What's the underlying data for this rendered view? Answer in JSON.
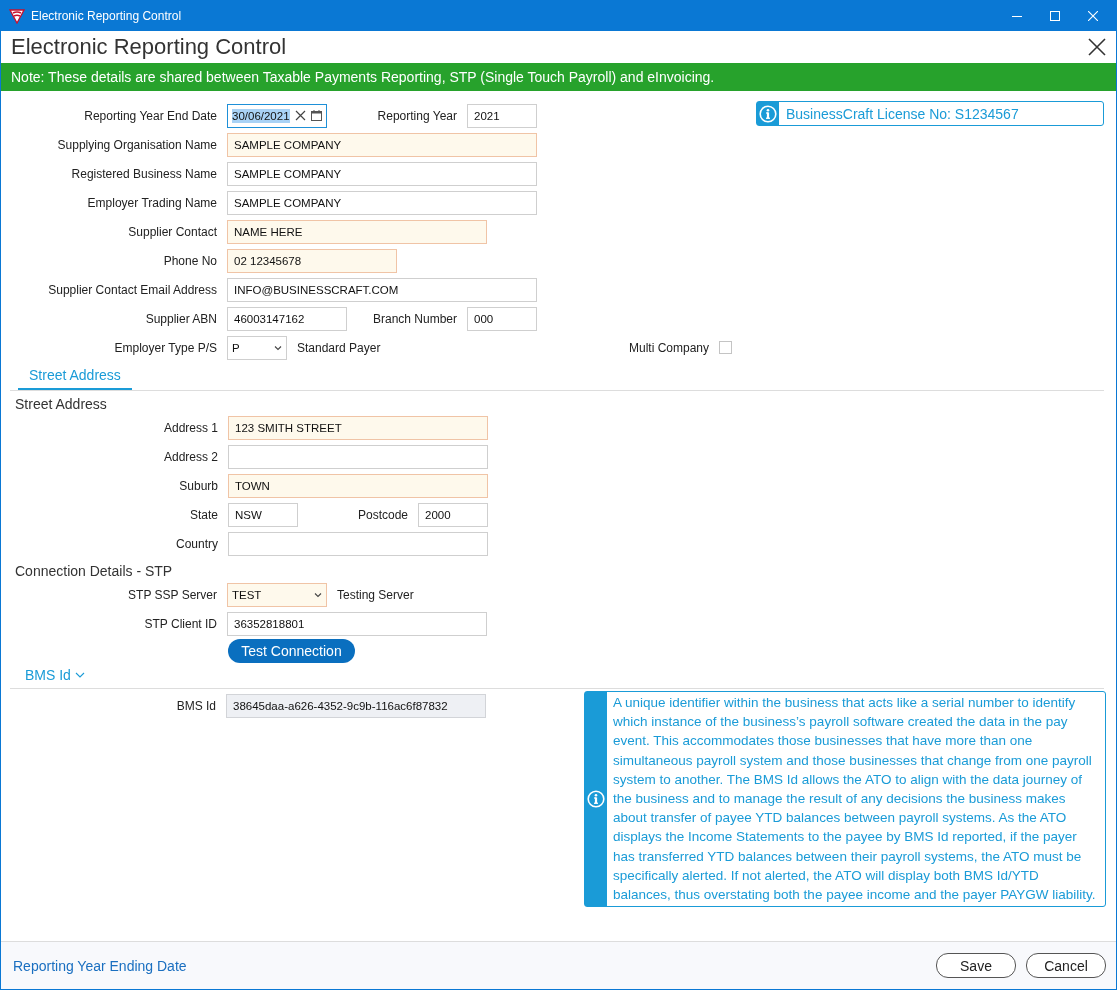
{
  "window": {
    "title": "Electronic Reporting Control"
  },
  "header": {
    "title": "Electronic Reporting Control"
  },
  "note": "Note: These details are shared between Taxable Payments Reporting, STP (Single Touch Payroll) and eInvoicing.",
  "license": "BusinessCraft License No: S1234567",
  "general_rows": [
    {
      "items": [
        {
          "kind": "label",
          "text": "Reporting Year End Date"
        },
        {
          "kind": "date",
          "value": "30/06/2021",
          "required": false,
          "readonly": false,
          "focused": true,
          "text_selected": true
        },
        {
          "kind": "label",
          "text": "Reporting Year"
        },
        {
          "kind": "text",
          "value": "2021",
          "required": false,
          "readonly": false,
          "focused": false
        }
      ]
    },
    {
      "items": [
        {
          "kind": "label",
          "text": "Supplying Organisation Name"
        },
        {
          "kind": "text",
          "value": "SAMPLE COMPANY",
          "required": true,
          "readonly": false,
          "focused": false
        }
      ]
    },
    {
      "items": [
        {
          "kind": "label",
          "text": "Registered Business Name"
        },
        {
          "kind": "text",
          "value": "SAMPLE COMPANY",
          "required": false,
          "readonly": false,
          "focused": false
        }
      ]
    },
    {
      "items": [
        {
          "kind": "label",
          "text": "Employer Trading Name"
        },
        {
          "kind": "text",
          "value": "SAMPLE COMPANY",
          "required": false,
          "readonly": false,
          "focused": false
        }
      ]
    },
    {
      "items": [
        {
          "kind": "label",
          "text": "Supplier Contact"
        },
        {
          "kind": "text",
          "value": "NAME HERE",
          "required": true,
          "readonly": false,
          "focused": false
        }
      ]
    },
    {
      "items": [
        {
          "kind": "label",
          "text": "Phone No"
        },
        {
          "kind": "text",
          "value": "02 12345678",
          "required": true,
          "readonly": false,
          "focused": false
        }
      ]
    },
    {
      "items": [
        {
          "kind": "label",
          "text": "Supplier Contact Email Address"
        },
        {
          "kind": "text",
          "value": "INFO@BUSINESSCRAFT.COM",
          "required": false,
          "readonly": false,
          "focused": false
        }
      ]
    },
    {
      "items": [
        {
          "kind": "label",
          "text": "Supplier ABN"
        },
        {
          "kind": "text",
          "value": "46003147162",
          "required": false,
          "readonly": false,
          "focused": false
        },
        {
          "kind": "label",
          "text": "Branch Number"
        },
        {
          "kind": "text",
          "value": "000",
          "required": false,
          "readonly": false,
          "focused": false
        }
      ]
    },
    {
      "items": [
        {
          "kind": "label",
          "text": "Employer Type P/S"
        },
        {
          "kind": "select",
          "value": "P",
          "required": false,
          "readonly": false,
          "focused": false
        },
        {
          "kind": "note",
          "text": "Standard Payer"
        },
        {
          "kind": "label",
          "text": "Multi Company"
        },
        {
          "kind": "checkbox",
          "checked": false
        }
      ]
    }
  ],
  "tabs": [
    {
      "label": "Street Address",
      "selected": true
    }
  ],
  "address": {
    "heading": "Street Address",
    "rows": [
      {
        "items": [
          {
            "kind": "label",
            "text": "Address 1"
          },
          {
            "kind": "text",
            "value": "123 SMITH STREET",
            "required": true,
            "readonly": false,
            "focused": false
          }
        ]
      },
      {
        "items": [
          {
            "kind": "label",
            "text": "Address 2"
          },
          {
            "kind": "text",
            "value": "",
            "required": false,
            "readonly": false,
            "focused": false
          }
        ]
      },
      {
        "items": [
          {
            "kind": "label",
            "text": "Suburb"
          },
          {
            "kind": "text",
            "value": "TOWN",
            "required": true,
            "readonly": false,
            "focused": false
          }
        ]
      },
      {
        "items": [
          {
            "kind": "label",
            "text": "State"
          },
          {
            "kind": "text",
            "value": "NSW",
            "required": false,
            "readonly": false,
            "focused": false
          },
          {
            "kind": "label",
            "text": "Postcode"
          },
          {
            "kind": "text",
            "value": "2000",
            "required": false,
            "readonly": false,
            "focused": false
          }
        ]
      },
      {
        "items": [
          {
            "kind": "label",
            "text": "Country"
          },
          {
            "kind": "text",
            "value": "",
            "required": false,
            "readonly": false,
            "focused": false
          }
        ]
      }
    ]
  },
  "connection": {
    "heading": "Connection Details - STP",
    "rows": [
      {
        "items": [
          {
            "kind": "label",
            "text": "STP SSP Server"
          },
          {
            "kind": "select",
            "value": "TEST",
            "required": true,
            "readonly": false,
            "focused": false
          },
          {
            "kind": "note",
            "text": "Testing Server"
          }
        ]
      },
      {
        "items": [
          {
            "kind": "label",
            "text": "STP Client ID"
          },
          {
            "kind": "text",
            "value": "36352818801",
            "required": false,
            "readonly": false,
            "focused": false
          }
        ]
      }
    ],
    "button": "Test Connection"
  },
  "bms": {
    "expander": {
      "label": "BMS Id",
      "expanded": true
    },
    "rows": [
      {
        "items": [
          {
            "kind": "label",
            "text": "BMS Id"
          },
          {
            "kind": "text",
            "value": "38645daa-a626-4352-9c9b-116ac6f87832",
            "required": false,
            "readonly": true,
            "focused": false
          }
        ]
      }
    ],
    "info": "A unique identifier within the business that acts like a serial number to identify which instance of the business’s payroll software created the data in the pay event. This accommodates those businesses that have more than one simultaneous payroll system and those businesses that change from one payroll system to another. The BMS Id allows the ATO to align with the data journey of the business and to manage the result of any decisions the business makes about transfer of payee YTD balances between payroll systems. As the ATO displays the Income Statements to the payee by BMS Id reported, if the payer has transferred YTD balances between their payroll systems, the ATO must be specifically alerted. If not alerted, the ATO will display both BMS Id/YTD balances, thus overstating both the payee income and the payer PAYGW liability."
  },
  "footer": {
    "link": "Reporting Year Ending Date",
    "buttons": [
      "Save",
      "Cancel"
    ]
  }
}
